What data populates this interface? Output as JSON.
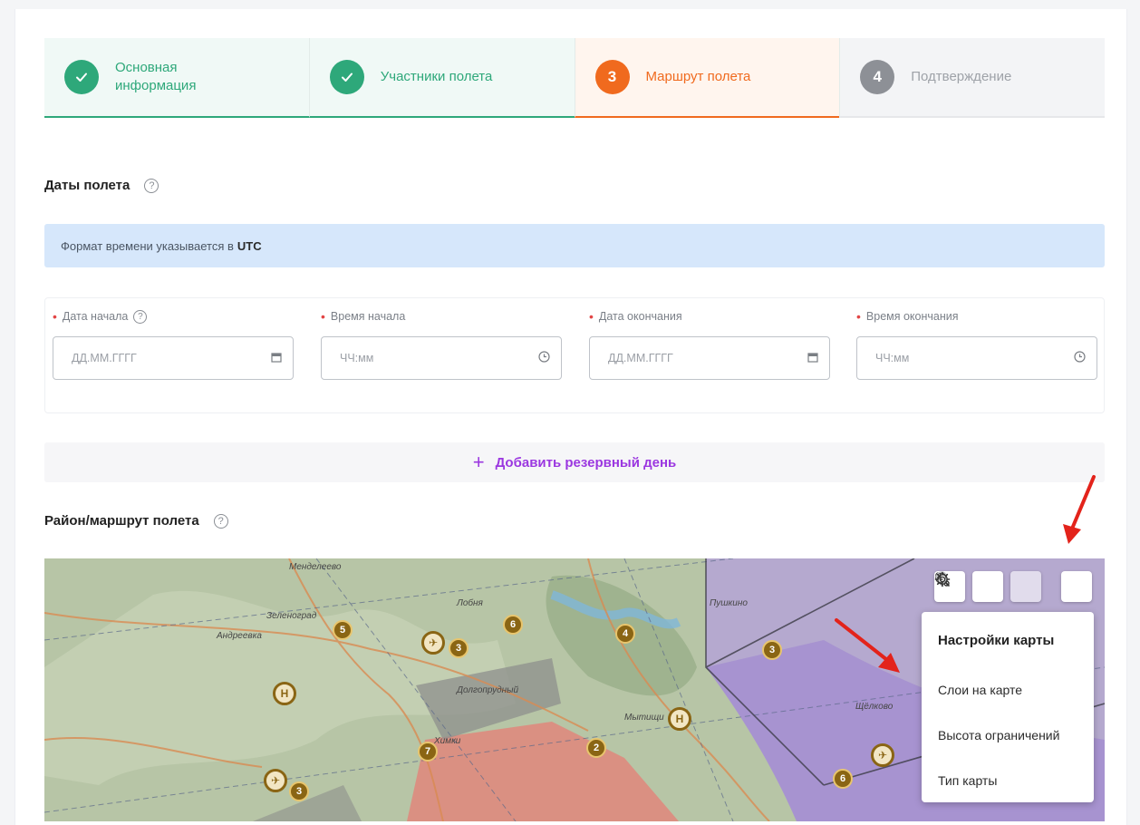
{
  "stepper": {
    "steps": [
      {
        "number": "✓",
        "label": "Основная информация",
        "state": "done"
      },
      {
        "number": "✓",
        "label": "Участники полета",
        "state": "done"
      },
      {
        "number": "3",
        "label": "Маршрут полета",
        "state": "active"
      },
      {
        "number": "4",
        "label": "Подтверждение",
        "state": "pending"
      }
    ]
  },
  "dates_section": {
    "title": "Даты полета",
    "notice_text": "Формат времени указывается в",
    "notice_bold": "UTC",
    "fields": [
      {
        "label": "Дата начала",
        "placeholder": "ДД.ММ.ГГГГ",
        "icon": "calendar-icon",
        "has_help": true
      },
      {
        "label": "Время начала",
        "placeholder": "ЧЧ:мм",
        "icon": "clock-icon",
        "has_help": false
      },
      {
        "label": "Дата окончания",
        "placeholder": "ДД.ММ.ГГГГ",
        "icon": "calendar-icon",
        "has_help": false
      },
      {
        "label": "Время окончания",
        "placeholder": "ЧЧ:мм",
        "icon": "clock-icon",
        "has_help": false
      }
    ],
    "add_day_label": "Добавить резервный день"
  },
  "route_section": {
    "title": "Район/маршрут полета"
  },
  "map": {
    "toolbar": [
      "search-icon",
      "route-icon",
      "pin-icon",
      "gear-icon"
    ],
    "settings_menu": {
      "title": "Настройки карты",
      "items": [
        "Слои на карте",
        "Высота ограничений",
        "Тип карты"
      ]
    },
    "place_labels": [
      "Зеленоград",
      "Андреевка",
      "Пушкино",
      "Долгопрудный",
      "Мытищи",
      "Химки",
      "Щёлково",
      "Лобня",
      "Менделеево"
    ],
    "markers": [
      "5",
      "3",
      "6",
      "4",
      "3",
      "H",
      "H",
      "7",
      "2",
      "6",
      "3"
    ]
  },
  "colors": {
    "accent_done": "#2ea87a",
    "accent_active": "#f06a1e",
    "link_purple": "#9b37e0",
    "notice_bg": "#d6e7fb"
  }
}
